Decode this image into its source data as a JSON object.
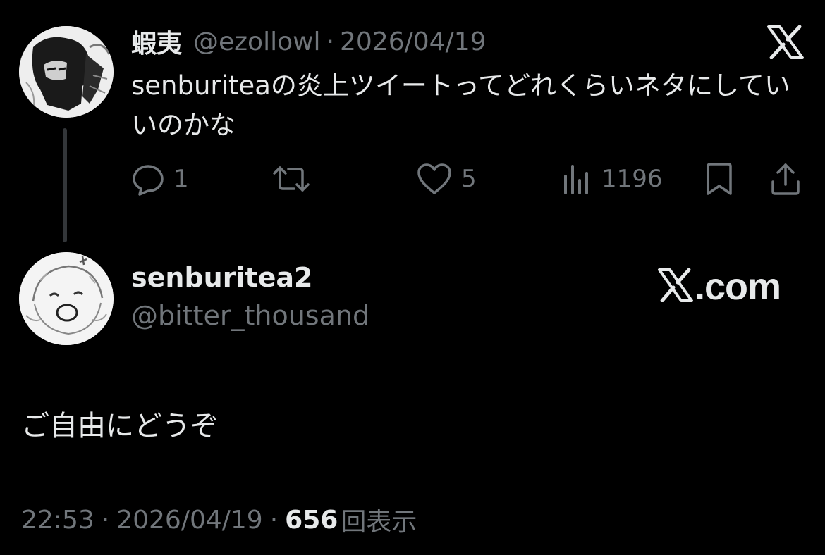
{
  "parent": {
    "display_name": "蝦夷",
    "handle": "@ezollowl",
    "separator": "·",
    "date": "2026/04/19",
    "text": "senburiteaの炎上ツイートってどれくらいネタにしていいのかな",
    "actions": {
      "reply_count": "1",
      "retweet_count": "",
      "like_count": "5",
      "view_count": "1196"
    }
  },
  "reply": {
    "display_name": "senburitea2",
    "handle": "@bitter_thousand",
    "brand": ".com",
    "text": "ご自由にどうぞ",
    "time": "22:53",
    "separator1": "·",
    "date": "2026/04/19",
    "separator2": "·",
    "views": "656",
    "views_label": "回表示"
  },
  "colors": {
    "background": "#000000",
    "primary_text": "#e7e9ea",
    "secondary_text": "#71767b",
    "thread_line": "#333639"
  },
  "icons": [
    "x-logo-icon",
    "reply-icon",
    "retweet-icon",
    "like-icon",
    "views-icon",
    "bookmark-icon",
    "share-icon"
  ]
}
